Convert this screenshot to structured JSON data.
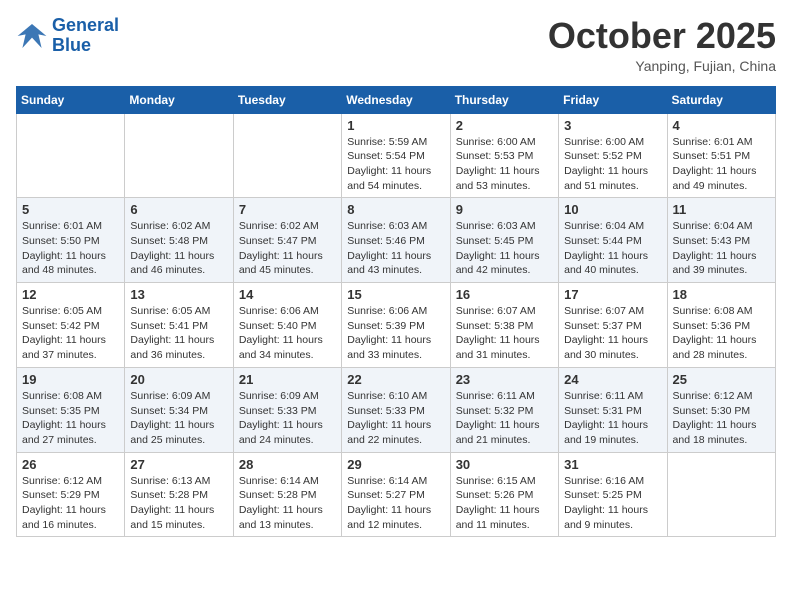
{
  "logo": {
    "text_general": "General",
    "text_blue": "Blue"
  },
  "header": {
    "month_year": "October 2025",
    "location": "Yanping, Fujian, China"
  },
  "weekdays": [
    "Sunday",
    "Monday",
    "Tuesday",
    "Wednesday",
    "Thursday",
    "Friday",
    "Saturday"
  ],
  "weeks": [
    [
      {
        "day": "",
        "sunrise": "",
        "sunset": "",
        "daylight": ""
      },
      {
        "day": "",
        "sunrise": "",
        "sunset": "",
        "daylight": ""
      },
      {
        "day": "",
        "sunrise": "",
        "sunset": "",
        "daylight": ""
      },
      {
        "day": "1",
        "sunrise": "Sunrise: 5:59 AM",
        "sunset": "Sunset: 5:54 PM",
        "daylight": "Daylight: 11 hours and 54 minutes."
      },
      {
        "day": "2",
        "sunrise": "Sunrise: 6:00 AM",
        "sunset": "Sunset: 5:53 PM",
        "daylight": "Daylight: 11 hours and 53 minutes."
      },
      {
        "day": "3",
        "sunrise": "Sunrise: 6:00 AM",
        "sunset": "Sunset: 5:52 PM",
        "daylight": "Daylight: 11 hours and 51 minutes."
      },
      {
        "day": "4",
        "sunrise": "Sunrise: 6:01 AM",
        "sunset": "Sunset: 5:51 PM",
        "daylight": "Daylight: 11 hours and 49 minutes."
      }
    ],
    [
      {
        "day": "5",
        "sunrise": "Sunrise: 6:01 AM",
        "sunset": "Sunset: 5:50 PM",
        "daylight": "Daylight: 11 hours and 48 minutes."
      },
      {
        "day": "6",
        "sunrise": "Sunrise: 6:02 AM",
        "sunset": "Sunset: 5:48 PM",
        "daylight": "Daylight: 11 hours and 46 minutes."
      },
      {
        "day": "7",
        "sunrise": "Sunrise: 6:02 AM",
        "sunset": "Sunset: 5:47 PM",
        "daylight": "Daylight: 11 hours and 45 minutes."
      },
      {
        "day": "8",
        "sunrise": "Sunrise: 6:03 AM",
        "sunset": "Sunset: 5:46 PM",
        "daylight": "Daylight: 11 hours and 43 minutes."
      },
      {
        "day": "9",
        "sunrise": "Sunrise: 6:03 AM",
        "sunset": "Sunset: 5:45 PM",
        "daylight": "Daylight: 11 hours and 42 minutes."
      },
      {
        "day": "10",
        "sunrise": "Sunrise: 6:04 AM",
        "sunset": "Sunset: 5:44 PM",
        "daylight": "Daylight: 11 hours and 40 minutes."
      },
      {
        "day": "11",
        "sunrise": "Sunrise: 6:04 AM",
        "sunset": "Sunset: 5:43 PM",
        "daylight": "Daylight: 11 hours and 39 minutes."
      }
    ],
    [
      {
        "day": "12",
        "sunrise": "Sunrise: 6:05 AM",
        "sunset": "Sunset: 5:42 PM",
        "daylight": "Daylight: 11 hours and 37 minutes."
      },
      {
        "day": "13",
        "sunrise": "Sunrise: 6:05 AM",
        "sunset": "Sunset: 5:41 PM",
        "daylight": "Daylight: 11 hours and 36 minutes."
      },
      {
        "day": "14",
        "sunrise": "Sunrise: 6:06 AM",
        "sunset": "Sunset: 5:40 PM",
        "daylight": "Daylight: 11 hours and 34 minutes."
      },
      {
        "day": "15",
        "sunrise": "Sunrise: 6:06 AM",
        "sunset": "Sunset: 5:39 PM",
        "daylight": "Daylight: 11 hours and 33 minutes."
      },
      {
        "day": "16",
        "sunrise": "Sunrise: 6:07 AM",
        "sunset": "Sunset: 5:38 PM",
        "daylight": "Daylight: 11 hours and 31 minutes."
      },
      {
        "day": "17",
        "sunrise": "Sunrise: 6:07 AM",
        "sunset": "Sunset: 5:37 PM",
        "daylight": "Daylight: 11 hours and 30 minutes."
      },
      {
        "day": "18",
        "sunrise": "Sunrise: 6:08 AM",
        "sunset": "Sunset: 5:36 PM",
        "daylight": "Daylight: 11 hours and 28 minutes."
      }
    ],
    [
      {
        "day": "19",
        "sunrise": "Sunrise: 6:08 AM",
        "sunset": "Sunset: 5:35 PM",
        "daylight": "Daylight: 11 hours and 27 minutes."
      },
      {
        "day": "20",
        "sunrise": "Sunrise: 6:09 AM",
        "sunset": "Sunset: 5:34 PM",
        "daylight": "Daylight: 11 hours and 25 minutes."
      },
      {
        "day": "21",
        "sunrise": "Sunrise: 6:09 AM",
        "sunset": "Sunset: 5:33 PM",
        "daylight": "Daylight: 11 hours and 24 minutes."
      },
      {
        "day": "22",
        "sunrise": "Sunrise: 6:10 AM",
        "sunset": "Sunset: 5:33 PM",
        "daylight": "Daylight: 11 hours and 22 minutes."
      },
      {
        "day": "23",
        "sunrise": "Sunrise: 6:11 AM",
        "sunset": "Sunset: 5:32 PM",
        "daylight": "Daylight: 11 hours and 21 minutes."
      },
      {
        "day": "24",
        "sunrise": "Sunrise: 6:11 AM",
        "sunset": "Sunset: 5:31 PM",
        "daylight": "Daylight: 11 hours and 19 minutes."
      },
      {
        "day": "25",
        "sunrise": "Sunrise: 6:12 AM",
        "sunset": "Sunset: 5:30 PM",
        "daylight": "Daylight: 11 hours and 18 minutes."
      }
    ],
    [
      {
        "day": "26",
        "sunrise": "Sunrise: 6:12 AM",
        "sunset": "Sunset: 5:29 PM",
        "daylight": "Daylight: 11 hours and 16 minutes."
      },
      {
        "day": "27",
        "sunrise": "Sunrise: 6:13 AM",
        "sunset": "Sunset: 5:28 PM",
        "daylight": "Daylight: 11 hours and 15 minutes."
      },
      {
        "day": "28",
        "sunrise": "Sunrise: 6:14 AM",
        "sunset": "Sunset: 5:28 PM",
        "daylight": "Daylight: 11 hours and 13 minutes."
      },
      {
        "day": "29",
        "sunrise": "Sunrise: 6:14 AM",
        "sunset": "Sunset: 5:27 PM",
        "daylight": "Daylight: 11 hours and 12 minutes."
      },
      {
        "day": "30",
        "sunrise": "Sunrise: 6:15 AM",
        "sunset": "Sunset: 5:26 PM",
        "daylight": "Daylight: 11 hours and 11 minutes."
      },
      {
        "day": "31",
        "sunrise": "Sunrise: 6:16 AM",
        "sunset": "Sunset: 5:25 PM",
        "daylight": "Daylight: 11 hours and 9 minutes."
      },
      {
        "day": "",
        "sunrise": "",
        "sunset": "",
        "daylight": ""
      }
    ]
  ]
}
